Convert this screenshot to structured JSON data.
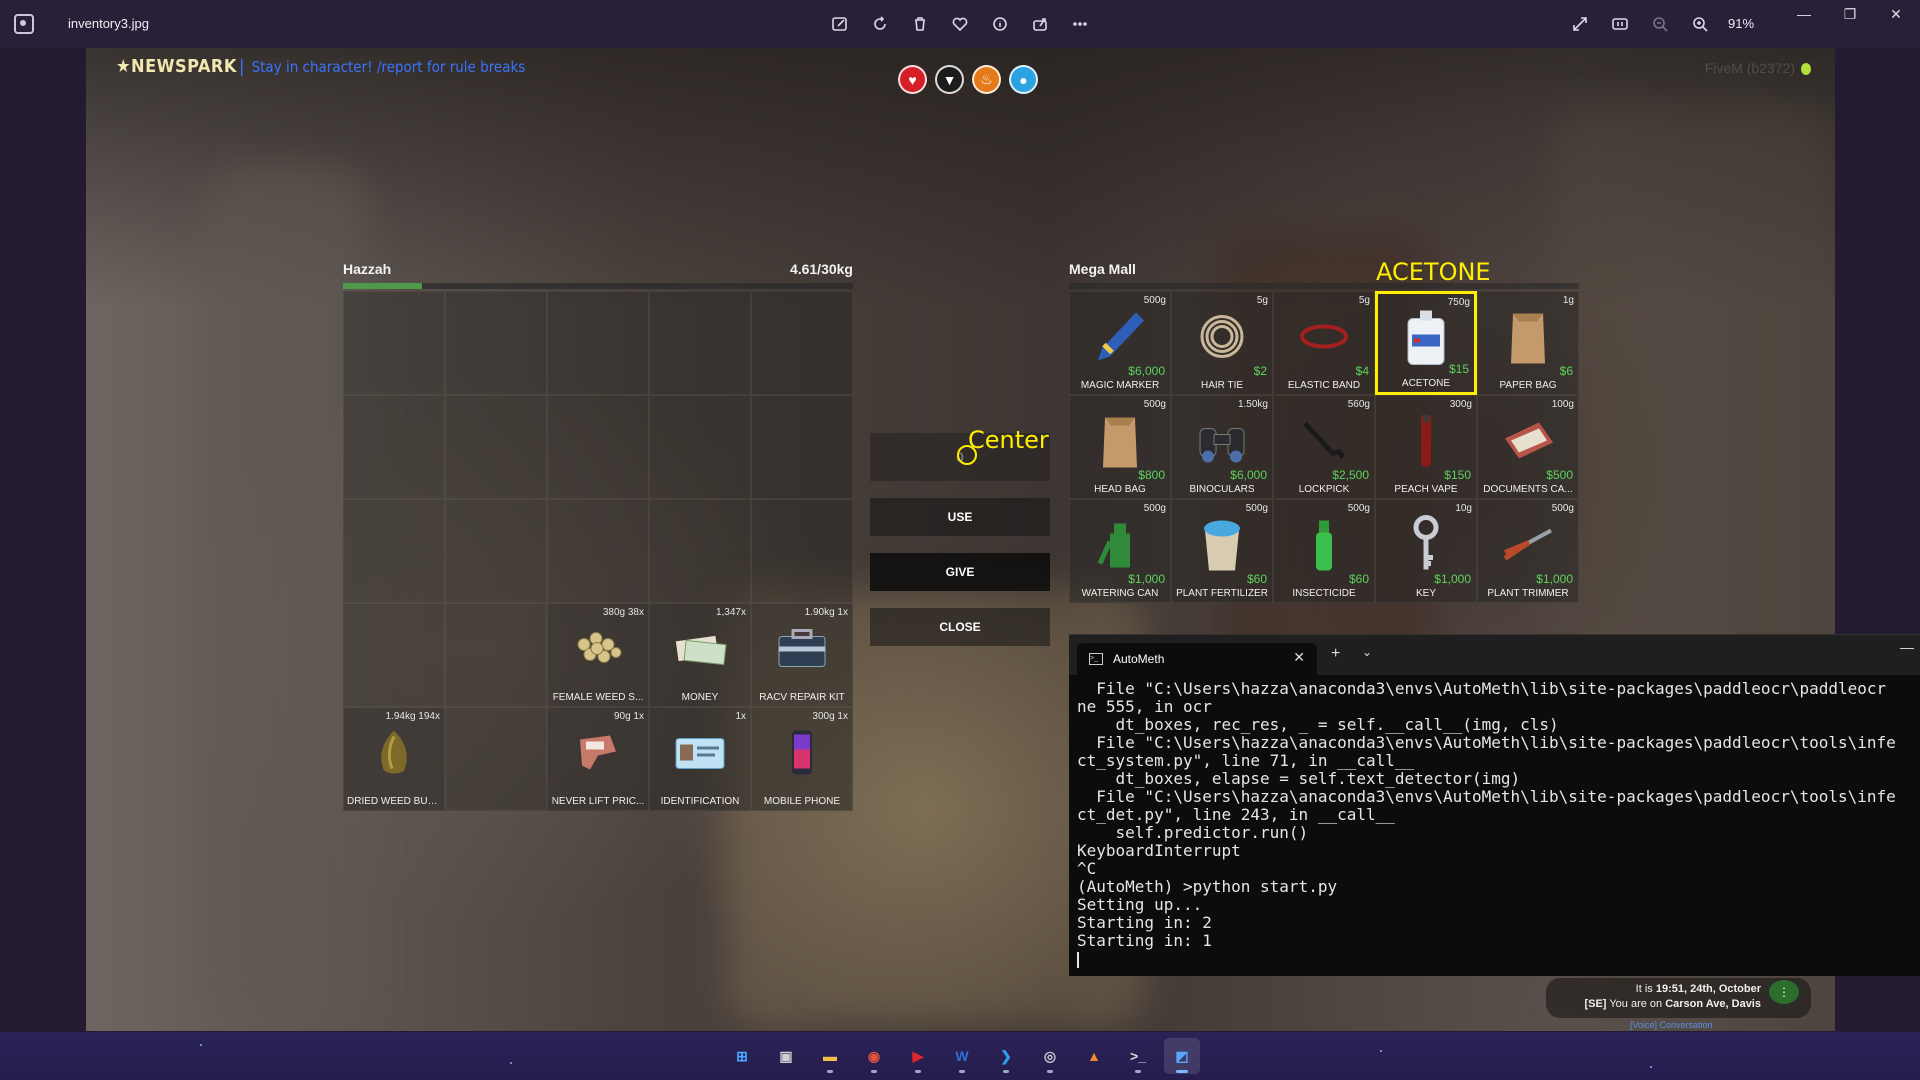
{
  "viewer": {
    "file_name": "inventory3.jpg",
    "zoom": "91%",
    "toolbar_icons": [
      "edit-icon",
      "rotate-icon",
      "delete-icon",
      "favorite-icon",
      "info-icon",
      "share-icon",
      "more-icon"
    ],
    "right_icons": [
      "fullscreen-icon",
      "actual-size-icon",
      "zoom-out-icon",
      "zoom-in-icon"
    ]
  },
  "hud": {
    "server_logo": "★NEWSPARK",
    "server_separator": "|",
    "server_tagline": "Stay in character! /report for rule breaks",
    "fivem_build": "FiveM (b2372)",
    "status_icons": [
      {
        "name": "health-icon",
        "glyph": "♥",
        "color": "#d41f26"
      },
      {
        "name": "armor-icon",
        "glyph": "▼",
        "color": "#1c1c1c"
      },
      {
        "name": "hunger-icon",
        "glyph": "♨",
        "color": "#e67a1a"
      },
      {
        "name": "thirst-icon",
        "glyph": "●",
        "color": "#2aa3e0"
      }
    ]
  },
  "player_inventory": {
    "name": "Hazzah",
    "weight": "4.61/30kg",
    "weight_fraction": 0.154,
    "slots": [
      {},
      {},
      {},
      {},
      {},
      {},
      {},
      {},
      {},
      {},
      {},
      {},
      {},
      {},
      {},
      {},
      {},
      {
        "meta": "380g 38x",
        "label": "FEMALE WEED S...",
        "icon": "seeds"
      },
      {
        "meta": "1,347x",
        "label": "MONEY",
        "icon": "money"
      },
      {
        "meta": "1.90kg 1x",
        "label": "RACV REPAIR KIT",
        "icon": "toolbox"
      },
      {
        "meta": "1.94kg 194x",
        "label": "DRIED WEED BUDS",
        "icon": "weed"
      },
      {},
      {
        "meta": "90g 1x",
        "label": "NEVER LIFT PRIC...",
        "icon": "pricegun"
      },
      {
        "meta": "1x",
        "label": "IDENTIFICATION",
        "icon": "idcard"
      },
      {
        "meta": "300g 1x",
        "label": "MOBILE PHONE",
        "icon": "phone"
      }
    ]
  },
  "actions": {
    "amount_value": "0",
    "use": "USE",
    "give": "GIVE",
    "close": "CLOSE"
  },
  "annotations": {
    "center_label": "Center",
    "target_label": "ACETONE"
  },
  "shop": {
    "name": "Mega Mall",
    "items": [
      {
        "meta": "500g",
        "label": "MAGIC MARKER",
        "price": "$6,000",
        "icon": "marker"
      },
      {
        "meta": "5g",
        "label": "HAIR TIE",
        "price": "$2",
        "icon": "hairtie"
      },
      {
        "meta": "5g",
        "label": "ELASTIC BAND",
        "price": "$4",
        "icon": "band"
      },
      {
        "meta": "750g",
        "label": "ACETONE",
        "price": "$15",
        "icon": "jug",
        "highlight": true
      },
      {
        "meta": "1g",
        "label": "PAPER BAG",
        "price": "$6",
        "icon": "bag"
      },
      {
        "meta": "500g",
        "label": "HEAD BAG",
        "price": "$800",
        "icon": "bag"
      },
      {
        "meta": "1.50kg",
        "label": "BINOCULARS",
        "price": "$6,000",
        "icon": "binoculars"
      },
      {
        "meta": "560g",
        "label": "LOCKPICK",
        "price": "$2,500",
        "icon": "lockpick"
      },
      {
        "meta": "300g",
        "label": "PEACH VAPE",
        "price": "$150",
        "icon": "vape"
      },
      {
        "meta": "100g",
        "label": "DOCUMENTS CA...",
        "price": "$500",
        "icon": "docs"
      },
      {
        "meta": "500g",
        "label": "WATERING CAN",
        "price": "$1,000",
        "icon": "can"
      },
      {
        "meta": "500g",
        "label": "PLANT FERTILIZER",
        "price": "$60",
        "icon": "fertilizer"
      },
      {
        "meta": "500g",
        "label": "INSECTICIDE",
        "price": "$60",
        "icon": "spray"
      },
      {
        "meta": "10g",
        "label": "KEY",
        "price": "$1,000",
        "icon": "key"
      },
      {
        "meta": "500g",
        "label": "PLANT TRIMMER",
        "price": "$1,000",
        "icon": "trimmer"
      }
    ]
  },
  "world": {
    "time_prefix": "It is ",
    "time": "19:51, 24th, October",
    "location_prefix": "[SE]",
    "location_mid": " You are on ",
    "location": "Carson Ave, Davis",
    "voice_status": "[Voice] Conversation"
  },
  "terminal": {
    "tab_title": "AutoMeth",
    "lines": [
      "  File \"C:\\Users\\hazza\\anaconda3\\envs\\AutoMeth\\lib\\site-packages\\paddleocr\\paddleocr",
      "ne 555, in ocr",
      "    dt_boxes, rec_res, _ = self.__call__(img, cls)",
      "  File \"C:\\Users\\hazza\\anaconda3\\envs\\AutoMeth\\lib\\site-packages\\paddleocr\\tools\\infe",
      "ct_system.py\", line 71, in __call__",
      "    dt_boxes, elapse = self.text_detector(img)",
      "  File \"C:\\Users\\hazza\\anaconda3\\envs\\AutoMeth\\lib\\site-packages\\paddleocr\\tools\\infe",
      "ct_det.py\", line 243, in __call__",
      "    self.predictor.run()",
      "KeyboardInterrupt",
      "^C",
      "(AutoMeth) >python start.py",
      "Setting up...",
      "Starting in: 2",
      "Starting in: 1"
    ]
  },
  "taskbar": {
    "apps": [
      {
        "name": "start-button",
        "glyph": "⊞",
        "color": "#4ea8ff",
        "running": false
      },
      {
        "name": "task-view-button",
        "glyph": "▣",
        "color": "#d0d0d0",
        "running": false
      },
      {
        "name": "file-explorer-app",
        "glyph": "▬",
        "color": "#f2c04a",
        "running": true
      },
      {
        "name": "chrome-app",
        "glyph": "◉",
        "color": "#e5533d",
        "running": true
      },
      {
        "name": "media-player-app",
        "glyph": "▶",
        "color": "#e0262b",
        "running": true
      },
      {
        "name": "word-app",
        "glyph": "W",
        "color": "#2b6fd6",
        "running": true
      },
      {
        "name": "vscode-app",
        "glyph": "❯",
        "color": "#2f9ce8",
        "running": true
      },
      {
        "name": "app-generic",
        "glyph": "◎",
        "color": "#c8c8d8",
        "running": true
      },
      {
        "name": "app-orange",
        "glyph": "▲",
        "color": "#f08a2c",
        "running": false
      },
      {
        "name": "terminal-app",
        "glyph": ">_",
        "color": "#d8d8d8",
        "running": true
      },
      {
        "name": "photos-app",
        "glyph": "◩",
        "color": "#56a8ff",
        "running": true,
        "active": true
      }
    ]
  }
}
